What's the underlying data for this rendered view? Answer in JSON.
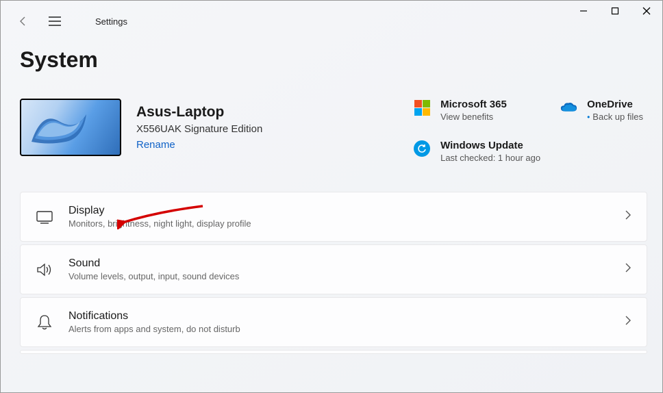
{
  "window": {
    "app_title": "Settings"
  },
  "page": {
    "title": "System"
  },
  "device": {
    "name": "Asus-Laptop",
    "model": "X556UAK Signature Edition",
    "rename_label": "Rename"
  },
  "tiles": {
    "ms365": {
      "title": "Microsoft 365",
      "sub": "View benefits"
    },
    "onedrive": {
      "title": "OneDrive",
      "sub": "Back up files"
    },
    "update": {
      "title": "Windows Update",
      "sub": "Last checked: 1 hour ago"
    }
  },
  "items": [
    {
      "title": "Display",
      "sub": "Monitors, brightness, night light, display profile"
    },
    {
      "title": "Sound",
      "sub": "Volume levels, output, input, sound devices"
    },
    {
      "title": "Notifications",
      "sub": "Alerts from apps and system, do not disturb"
    }
  ]
}
